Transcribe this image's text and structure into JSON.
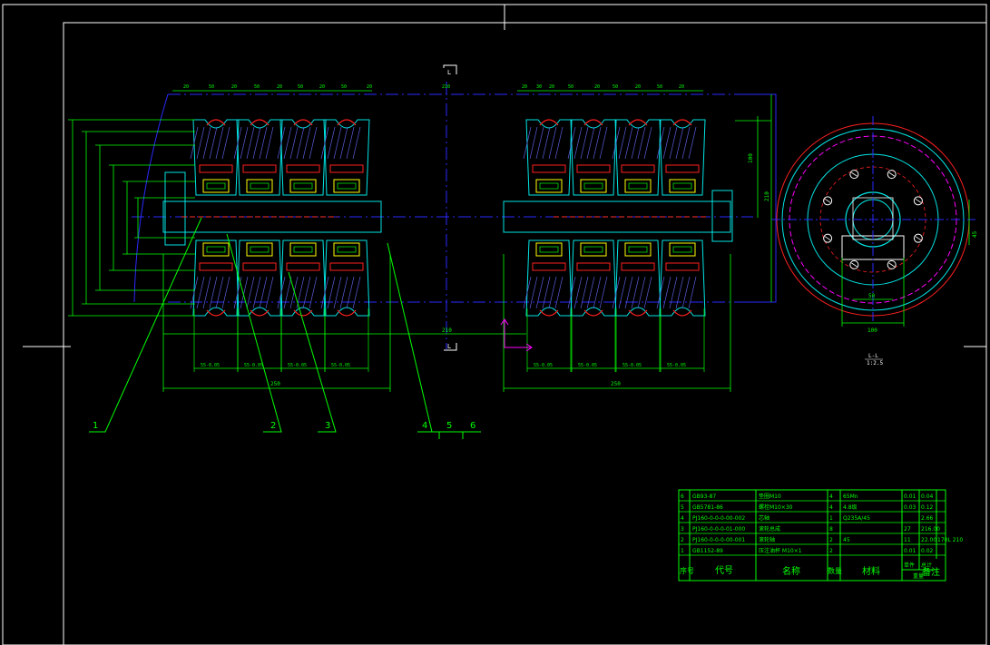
{
  "colors": {
    "background": "#000000",
    "frame": "#ffffff",
    "dimension": "#00ff00",
    "outline": "#00ffff",
    "centerline": "#0000ff",
    "hidden": "#ff00ff",
    "section": "#ff2020",
    "bearing": "#ffff00",
    "hatch": "#5a5ad8"
  },
  "callouts": [
    "1",
    "2",
    "3",
    "4",
    "5",
    "6"
  ],
  "section_marks": {
    "top": "L",
    "bottom": "L"
  },
  "section_view": {
    "title": "L-L",
    "scale": "1:2.5"
  },
  "dimensions": {
    "pitch_top": [
      "20",
      "50",
      "20",
      "50",
      "20",
      "50",
      "20",
      "50",
      "20",
      "210",
      "20",
      "30",
      "20",
      "50",
      "20",
      "50",
      "20",
      "50",
      "20"
    ],
    "overall_left": "250",
    "overall_right": "250",
    "center_span": "210",
    "bottom_fit": "55-0.05",
    "right_side": [
      "100",
      "210"
    ],
    "section_bottom": "100",
    "section_inner": "50",
    "section_right": "45"
  },
  "title_block": {
    "rows": [
      {
        "no": "6",
        "code": "GB93-87",
        "name": "垫圈M10",
        "qty": "4",
        "material": "65Mn",
        "unit_w": "0.01",
        "total_w": "0.04",
        "note": ""
      },
      {
        "no": "5",
        "code": "GB5781-86",
        "name": "螺栓M10×30",
        "qty": "4",
        "material": "4.8级",
        "unit_w": "0.03",
        "total_w": "0.12",
        "note": ""
      },
      {
        "no": "4",
        "code": "PJ160-0-0-0-00-002",
        "name": "芯轴",
        "qty": "1",
        "material": "Q235A/45",
        "unit_w": "",
        "total_w": "2.66",
        "note": ""
      },
      {
        "no": "3",
        "code": "PJ160-0-0-0-01-000",
        "name": "滚轮总成",
        "qty": "8",
        "material": "",
        "unit_w": "27",
        "total_w": "216.00",
        "note": ""
      },
      {
        "no": "2",
        "code": "PJ160-0-0-0-00-001",
        "name": "滚轮轴",
        "qty": "2",
        "material": "45",
        "unit_w": "11",
        "total_w": "22.00",
        "note": "170L 210"
      },
      {
        "no": "1",
        "code": "GB1152-89",
        "name": "压注油杯 M10×1",
        "qty": "2",
        "material": "",
        "unit_w": "0.01",
        "total_w": "0.02",
        "note": ""
      }
    ],
    "header": {
      "no": "序号",
      "code": "代号",
      "name": "名称",
      "qty": "数量",
      "material": "材料",
      "unit_w": "单件",
      "total_w": "总计",
      "weight": "重量",
      "note": "备注"
    }
  }
}
